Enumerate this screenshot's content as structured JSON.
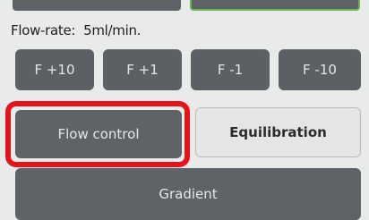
{
  "flow_rate": {
    "label": "Flow-rate:",
    "value": "5ml/min."
  },
  "step_buttons": [
    {
      "label": "F +10"
    },
    {
      "label": "F +1"
    },
    {
      "label": "F -1"
    },
    {
      "label": "F -10"
    }
  ],
  "modes": {
    "flow_control": "Flow control",
    "equilibration": "Equilibration",
    "gradient": "Gradient"
  },
  "colors": {
    "button_dark": "#5f6266",
    "highlight": "#e5141b",
    "active_border": "#6fb35a",
    "background": "#e9ebea"
  }
}
